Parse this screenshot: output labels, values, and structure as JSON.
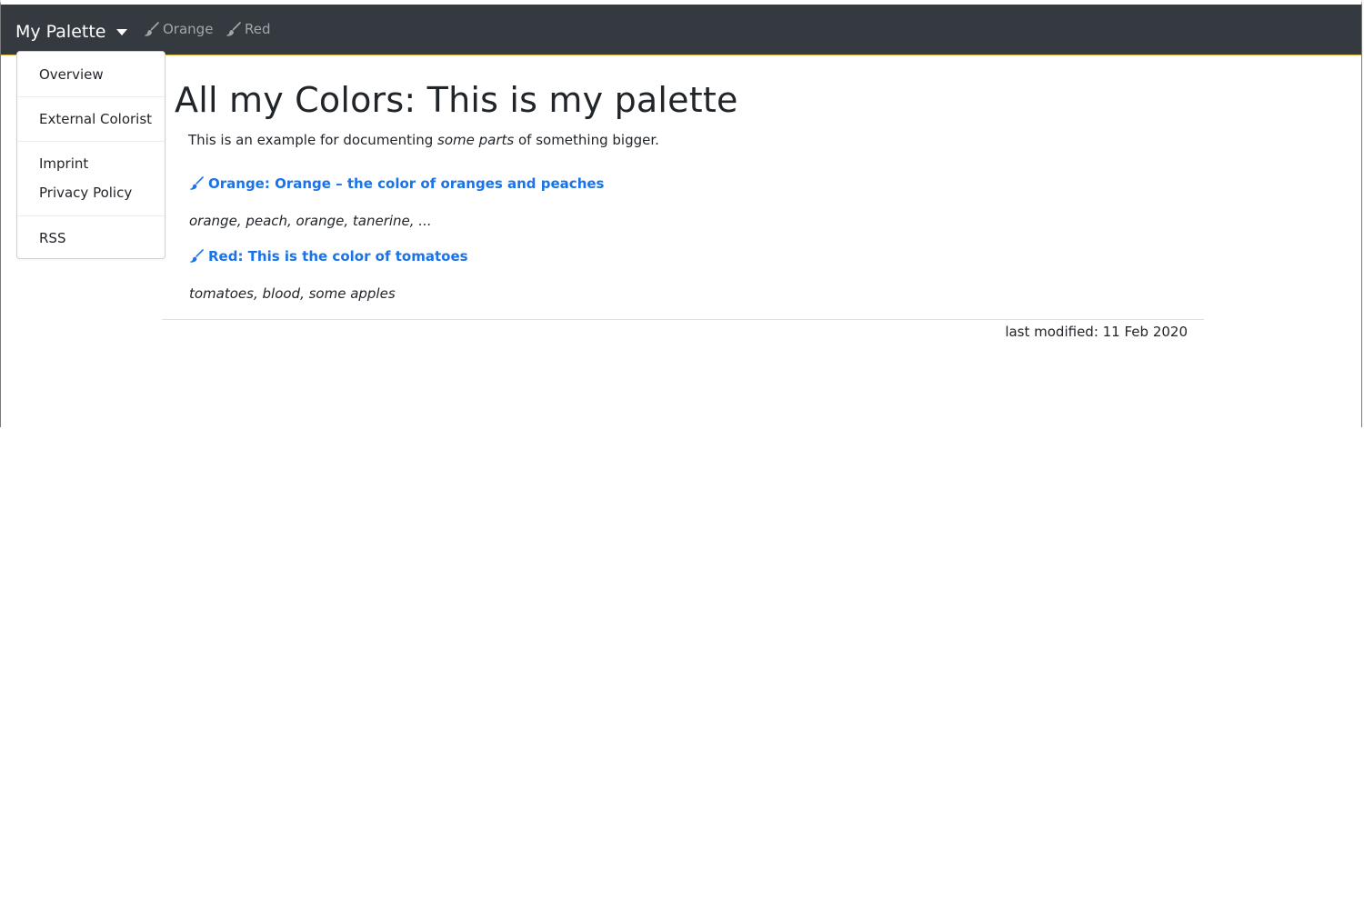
{
  "navbar": {
    "brand": "My Palette",
    "links": [
      {
        "label": "Orange",
        "icon": "paintbrush-icon"
      },
      {
        "label": "Red",
        "icon": "paintbrush-icon"
      }
    ],
    "background_color": "#343a40",
    "accent_color": "#e0b43c"
  },
  "dropdown": {
    "items": [
      "Overview",
      "External Colorist",
      "Imprint",
      "Privacy Policy",
      "RSS"
    ]
  },
  "main": {
    "title": "All my Colors: This is my palette",
    "intro_before": "This is an example for documenting ",
    "intro_em": "some parts",
    "intro_after": " of something bigger.",
    "entries": [
      {
        "link": "Orange: Orange – the color of oranges and peaches",
        "description": "orange, peach, orange, tanerine, ...",
        "icon": "paintbrush-icon"
      },
      {
        "link": "Red: This is the color of tomatoes",
        "description": "tomatoes, blood, some apples",
        "icon": "paintbrush-icon"
      }
    ],
    "link_color": "#1a73e8"
  },
  "footer": {
    "last_modified": "last modified: 11 Feb 2020"
  }
}
